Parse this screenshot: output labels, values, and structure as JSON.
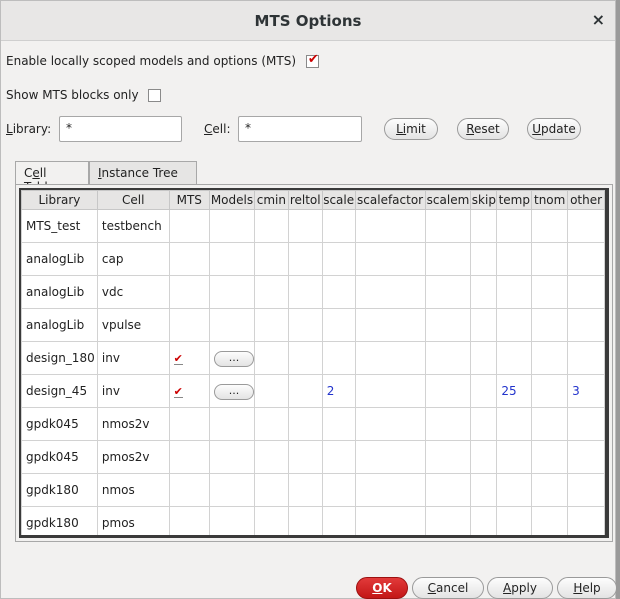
{
  "window": {
    "title": "MTS Options",
    "close_glyph": "×"
  },
  "options": {
    "enable_label": "Enable locally scoped models and options (MTS)",
    "enable_checked": true,
    "show_blocks_label": "Show MTS blocks only",
    "show_blocks_checked": false
  },
  "filter": {
    "library_label_u": "L",
    "library_label_rest": "ibrary:",
    "library_value": "*",
    "cell_label_u": "C",
    "cell_label_rest": "ell:",
    "cell_value": "*",
    "limit_u": "Li",
    "limit_rest": "mit",
    "reset_u": "R",
    "reset_rest": "eset",
    "update_u": "U",
    "update_rest": "pdate"
  },
  "tabs": [
    {
      "pre": "C",
      "u": "e",
      "post": "ll Table",
      "active": true
    },
    {
      "pre": "",
      "u": "I",
      "post": "nstance Tree",
      "active": false
    }
  ],
  "table": {
    "headers": [
      "Library",
      "Cell",
      "MTS",
      "Models",
      "cmin",
      "reltol",
      "scale",
      "scalefactor",
      "scalem",
      "skip",
      "temp",
      "tnom",
      "other"
    ],
    "models_button": "...",
    "check_glyph": "✔",
    "rows": [
      {
        "library": "MTS_test",
        "cell": "testbench",
        "mts": false,
        "models": false,
        "scale": "",
        "temp": "",
        "other": ""
      },
      {
        "library": "analogLib",
        "cell": "cap",
        "mts": false,
        "models": false,
        "scale": "",
        "temp": "",
        "other": ""
      },
      {
        "library": "analogLib",
        "cell": "vdc",
        "mts": false,
        "models": false,
        "scale": "",
        "temp": "",
        "other": ""
      },
      {
        "library": "analogLib",
        "cell": "vpulse",
        "mts": false,
        "models": false,
        "scale": "",
        "temp": "",
        "other": ""
      },
      {
        "library": "design_180",
        "cell": "inv",
        "mts": true,
        "models": true,
        "scale": "",
        "temp": "",
        "other": ""
      },
      {
        "library": "design_45",
        "cell": "inv",
        "mts": true,
        "models": true,
        "scale": "2",
        "temp": "25",
        "other": "3"
      },
      {
        "library": "gpdk045",
        "cell": "nmos2v",
        "mts": false,
        "models": false,
        "scale": "",
        "temp": "",
        "other": ""
      },
      {
        "library": "gpdk045",
        "cell": "pmos2v",
        "mts": false,
        "models": false,
        "scale": "",
        "temp": "",
        "other": ""
      },
      {
        "library": "gpdk180",
        "cell": "nmos",
        "mts": false,
        "models": false,
        "scale": "",
        "temp": "",
        "other": ""
      },
      {
        "library": "gpdk180",
        "cell": "pmos",
        "mts": false,
        "models": false,
        "scale": "",
        "temp": "",
        "other": ""
      }
    ]
  },
  "footer": {
    "ok_u": "O",
    "ok_rest": "K",
    "cancel_u": "C",
    "cancel_rest": "ancel",
    "apply_u": "A",
    "apply_rest": "pply",
    "help_u": "H",
    "help_rest": "elp"
  },
  "colors": {
    "ok_button": "#c31616",
    "check": "#cc0000",
    "value_text": "#2233cc"
  }
}
